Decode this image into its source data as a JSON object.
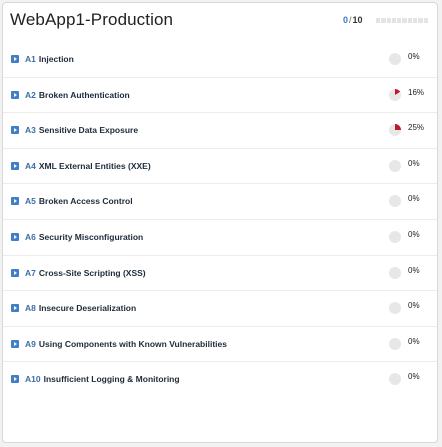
{
  "app": {
    "title": "WebApp1-Production",
    "score_current": "0",
    "score_total": "10",
    "progress_fraction": 0
  },
  "colors": {
    "accent": "#3a7bbf",
    "pie_fill": "#c0182a",
    "pie_bg": "#e7e7e7"
  },
  "items": [
    {
      "code": "A1",
      "name": "Injection",
      "percent_label": "0%",
      "percent": 0
    },
    {
      "code": "A2",
      "name": "Broken Authentication",
      "percent_label": "16%",
      "percent": 16
    },
    {
      "code": "A3",
      "name": "Sensitive Data Exposure",
      "percent_label": "25%",
      "percent": 25
    },
    {
      "code": "A4",
      "name": "XML External Entities (XXE)",
      "percent_label": "0%",
      "percent": 0
    },
    {
      "code": "A5",
      "name": "Broken Access Control",
      "percent_label": "0%",
      "percent": 0
    },
    {
      "code": "A6",
      "name": "Security Misconfiguration",
      "percent_label": "0%",
      "percent": 0
    },
    {
      "code": "A7",
      "name": "Cross-Site Scripting (XSS)",
      "percent_label": "0%",
      "percent": 0
    },
    {
      "code": "A8",
      "name": "Insecure Deserialization",
      "percent_label": "0%",
      "percent": 0
    },
    {
      "code": "A9",
      "name": "Using Components with Known Vulnerabilities",
      "percent_label": "0%",
      "percent": 0
    },
    {
      "code": "A10",
      "name": "Insufficient Logging & Monitoring",
      "percent_label": "0%",
      "percent": 0
    }
  ]
}
